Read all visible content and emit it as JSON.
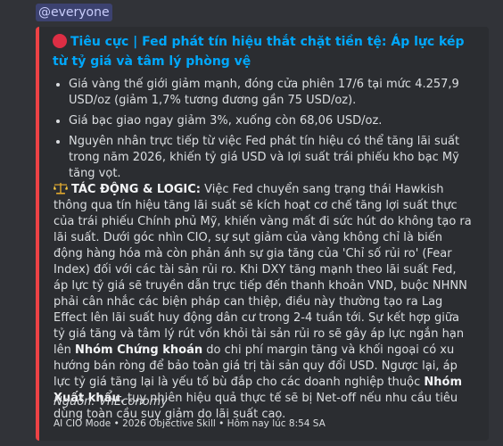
{
  "mention": "@everyone",
  "embed": {
    "accent_color": "#ed4245",
    "title_icon": "red-circle-icon",
    "title": "Tiêu cực | Fed phát tín hiệu thắt chặt tiền tệ: Áp lực kép từ tỷ giá và tâm lý phòng vệ",
    "bullets": [
      "Giá vàng thế giới giảm mạnh, đóng cửa phiên 17/6 tại mức 4.257,9 USD/oz (giảm 1,7% tương đương gần 75 USD/oz).",
      "Giá bạc giao ngay giảm 3%, xuống còn 68,06 USD/oz.",
      "Nguyên nhân trực tiếp từ việc Fed phát tín hiệu có thể tăng lãi suất trong năm 2026, khiến tỷ giá USD và lợi suất trái phiếu kho bạc Mỹ tăng vọt."
    ],
    "impact": {
      "icon": "balance-scale-icon",
      "heading": "TÁC ĐỘNG & LOGIC:",
      "text1": " Việc Fed chuyển sang trạng thái Hawkish thông qua tín hiệu tăng lãi suất sẽ kích hoạt cơ chế tăng lợi suất thực của trái phiếu Chính phủ Mỹ, khiến vàng mất đi sức hút do không tạo ra lãi suất. Dưới góc nhìn CIO, sự sụt giảm của vàng không chỉ là biến động hàng hóa mà còn phản ánh sự gia tăng của 'Chỉ số rủi ro' (Fear Index) đối với các tài sản rủi ro. Khi DXY tăng mạnh theo lãi suất Fed, áp lực tỷ giá sẽ truyền dẫn trực tiếp đến thanh khoản VND, buộc NHNN phải cân nhắc các biện pháp can thiệp, điều này thường tạo ra Lag Effect lên lãi suất huy động dân cư trong 2-4 tuần tới. Sự kết hợp giữa tỷ giá tăng và tâm lý rút vốn khỏi tài sản rủi ro sẽ gây áp lực ngắn hạn lên ",
      "bold1": "Nhóm Chứng khoán",
      "text2": " do chi phí margin tăng và khối ngoại có xu hướng bán ròng để bảo toàn giá trị tài sản quy đổi USD. Ngược lại, áp lực tỷ giá tăng lại là yếu tố bù đắp cho các doanh nghiệp thuộc ",
      "bold2": "Nhóm Xuất khẩu",
      "text3": ", tuy nhiên hiệu quả thực tế sẽ bị Net-off nếu nhu cầu tiêu dùng toàn cầu suy giảm do lãi suất cao."
    },
    "source": "Nguồn: VnEconomy",
    "footer": "AI CIO Mode • 2026 Objective Skill • Hôm nay lúc 8:54 SA"
  }
}
